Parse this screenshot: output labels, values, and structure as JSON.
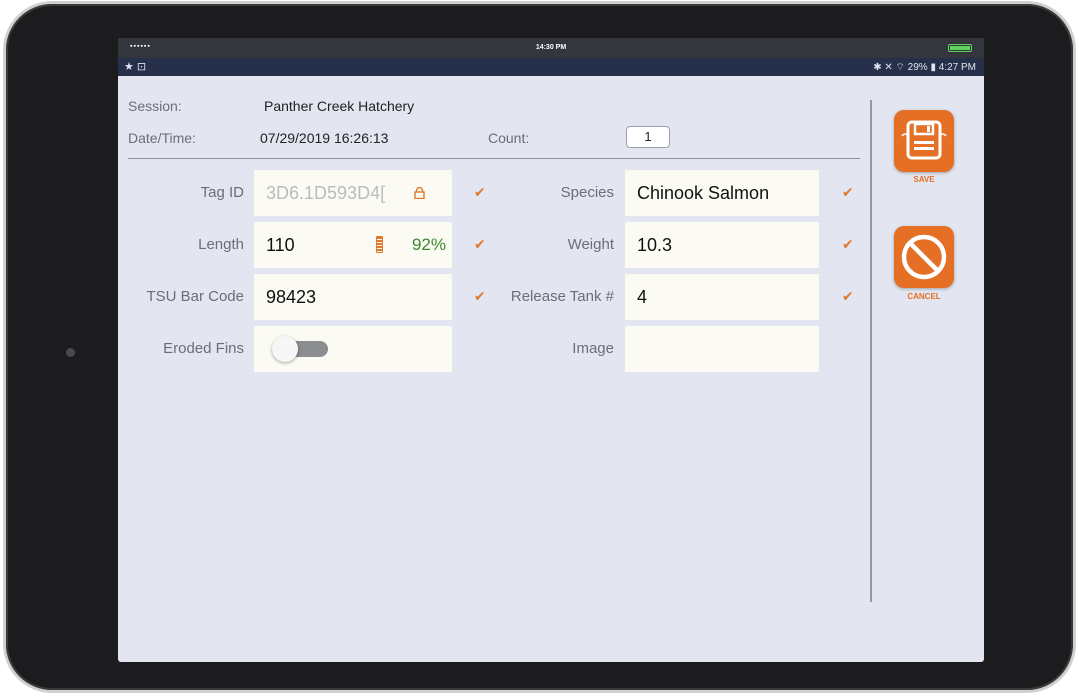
{
  "status_ios": {
    "signal": "▪▪▪▪▪▪",
    "time": "14:30 PM"
  },
  "status_android": {
    "left_icons": "★ ⊡",
    "right_text": "✱ ✕ ⌔ 29% ▮ 4:27 PM"
  },
  "header": {
    "session_label": "Session:",
    "session_value": "Panther Creek Hatchery",
    "datetime_label": "Date/Time:",
    "datetime_value": "07/29/2019 16:26:13",
    "count_label": "Count:",
    "count_value": "1"
  },
  "form": {
    "tag_id": {
      "label": "Tag ID",
      "value": "3D6.1D593D4["
    },
    "length": {
      "label": "Length",
      "value": "110",
      "battery_percent": "92%"
    },
    "tsu_bar_code": {
      "label": "TSU Bar Code",
      "value": "98423"
    },
    "eroded_fins": {
      "label": "Eroded Fins",
      "toggle_on": false
    },
    "species": {
      "label": "Species",
      "value": "Chinook Salmon"
    },
    "weight": {
      "label": "Weight",
      "value": "10.3"
    },
    "release_tank": {
      "label": "Release Tank #",
      "value": "4"
    },
    "image": {
      "label": "Image",
      "value": ""
    }
  },
  "actions": {
    "save_label": "SAVE",
    "cancel_label": "CANCEL"
  },
  "colors": {
    "accent": "#e46f25",
    "check": "#e07a2e",
    "battery_good": "#3b8a2f",
    "screen_bg": "#e3e6f1"
  },
  "icons": {
    "check": "✔",
    "lock": "lock-icon",
    "battery": "battery-icon",
    "save": "floppy-disk-icon",
    "cancel": "prohibited-icon"
  }
}
